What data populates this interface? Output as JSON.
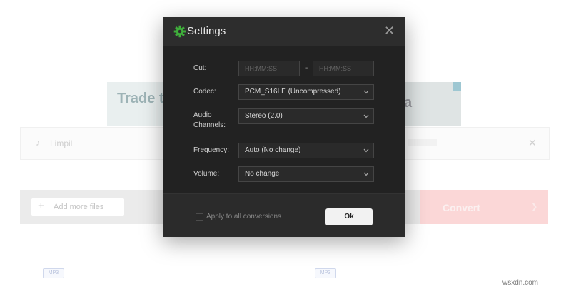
{
  "background": {
    "ad": {
      "headline": "Trade th",
      "right_text": "a"
    },
    "file": {
      "name": "Limpil"
    },
    "add_files_label": "Add more files",
    "convert_label": "Convert",
    "format_badge_1": "MP3",
    "format_badge_2": "MP3",
    "watermark": "wsxdn.com"
  },
  "modal": {
    "title": "Settings",
    "icon": "gear-icon",
    "accent_color": "#3fae3b",
    "cut": {
      "label": "Cut:",
      "start_placeholder": "HH:MM:SS",
      "end_placeholder": "HH:MM:SS",
      "separator": "-"
    },
    "codec": {
      "label": "Codec:",
      "value": "PCM_S16LE (Uncompressed)"
    },
    "channels": {
      "label_line1": "Audio",
      "label_line2": "Channels:",
      "value": "Stereo (2.0)"
    },
    "frequency": {
      "label": "Frequency:",
      "value": "Auto (No change)"
    },
    "volume": {
      "label": "Volume:",
      "value": "No change"
    },
    "apply_all_label": "Apply to all conversions",
    "ok_label": "Ok"
  }
}
